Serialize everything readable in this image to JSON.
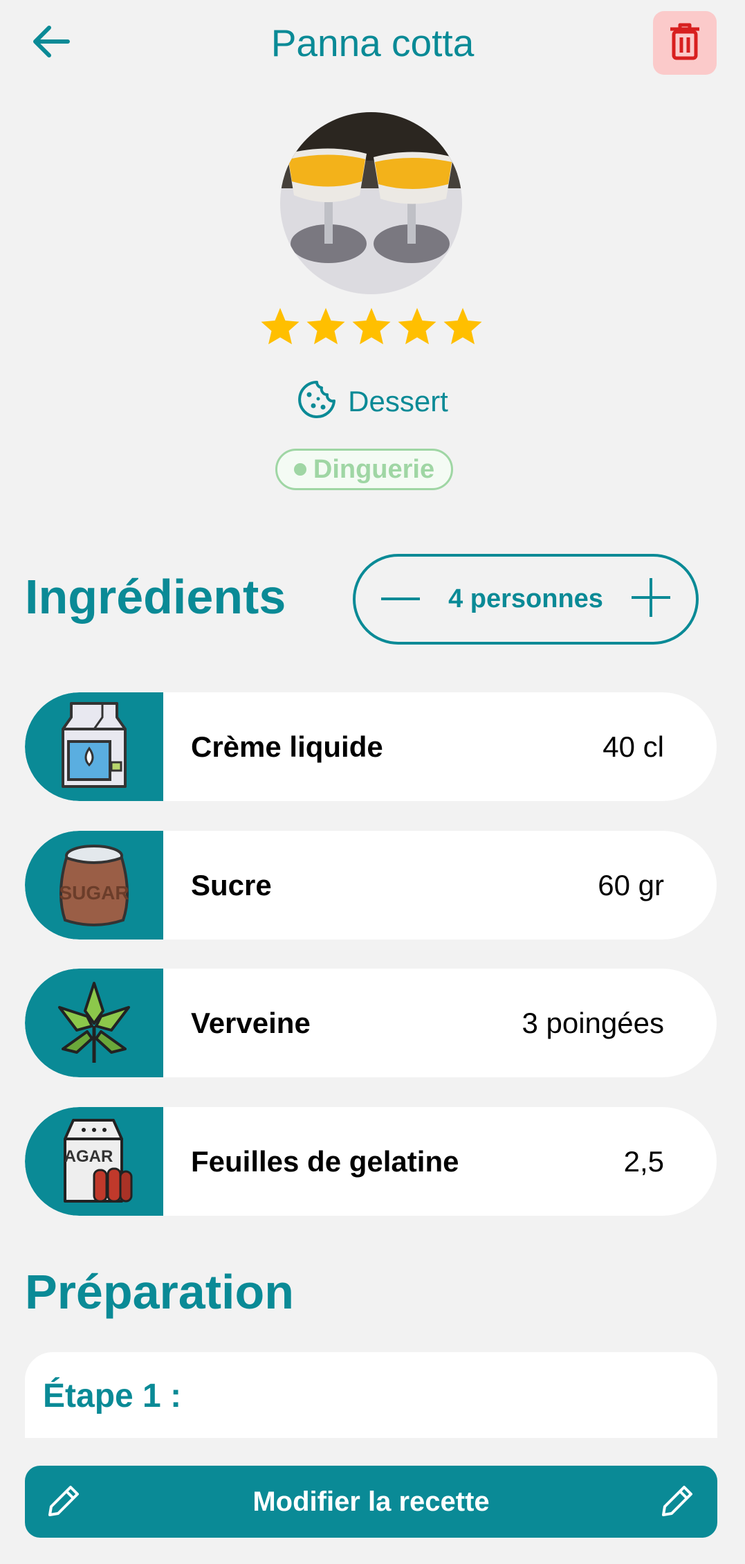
{
  "header": {
    "title": "Panna cotta"
  },
  "rating": {
    "value": 5,
    "max": 5
  },
  "category": {
    "label": "Dessert"
  },
  "tag": {
    "label": "Dinguerie"
  },
  "ingredients_section": {
    "title": "Ingrédients",
    "servings_label": "4 personnes"
  },
  "ingredients": [
    {
      "name": "Crème liquide",
      "qty": "40 cl",
      "icon": "milk-carton-icon"
    },
    {
      "name": "Sucre",
      "qty": "60 gr",
      "icon": "sugar-sack-icon"
    },
    {
      "name": "Verveine",
      "qty": "3 poingées",
      "icon": "herb-leaf-icon"
    },
    {
      "name": "Feuilles de gelatine",
      "qty": "2,5",
      "icon": "agar-bag-icon"
    }
  ],
  "preparation": {
    "title": "Préparation",
    "step_label": "Étape 1 :"
  },
  "edit_button": {
    "label": "Modifier la recette"
  },
  "colors": {
    "accent": "#0a8a96",
    "star": "#ffbf00",
    "delete_bg": "#fbcaca",
    "delete_icon": "#d81f1f",
    "tag": "#9fd6a4"
  }
}
